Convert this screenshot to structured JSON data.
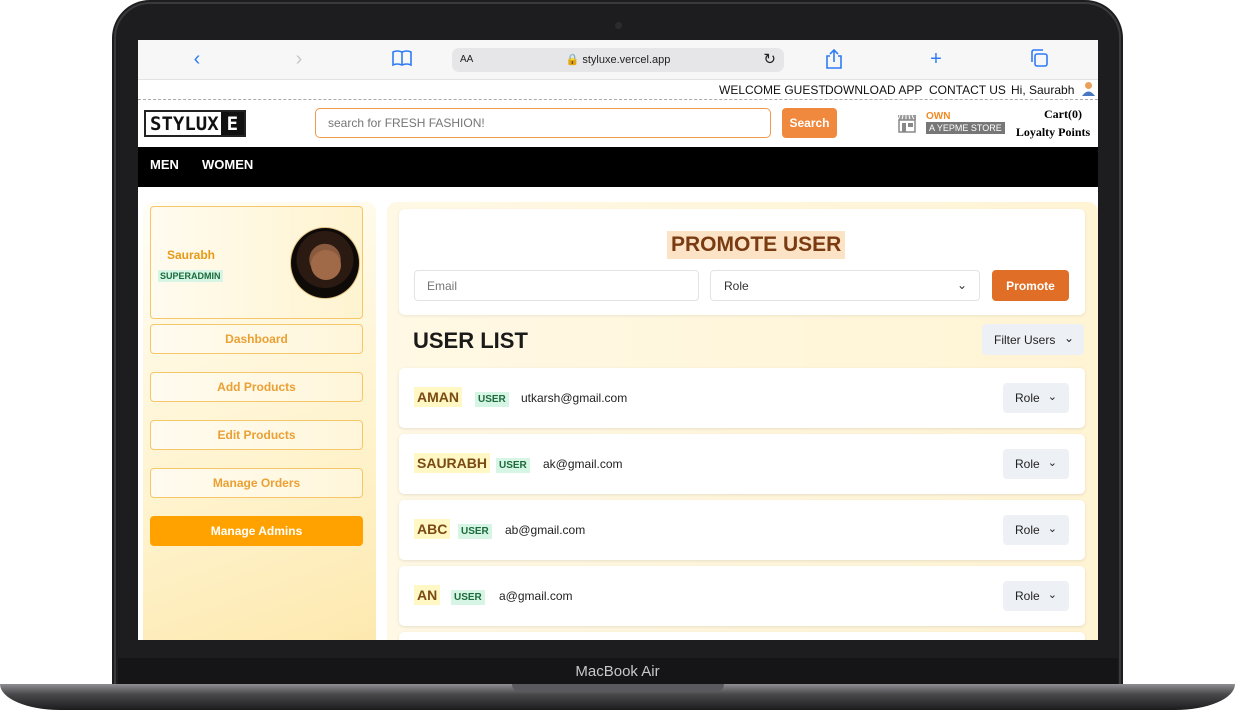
{
  "device": {
    "label": "MacBook Air"
  },
  "browser": {
    "aa": "AA",
    "url": "styluxe.vercel.app"
  },
  "top_links": {
    "welcome": "WELCOME GUEST",
    "download": "DOWNLOAD APP",
    "contact": "CONTACT US",
    "greeting": "Hi, Saurabh"
  },
  "header": {
    "logo_main": "STYLUX",
    "logo_end": "E",
    "search_placeholder": "search for FRESH FASHION!",
    "search_label": "Search",
    "own_label": "OWN",
    "store_label": "A YEPME STORE",
    "cart_label": "Cart(0)",
    "loyalty_label": "Loyalty Points"
  },
  "nav": {
    "men": "MEN",
    "women": "WOMEN"
  },
  "sidebar": {
    "profile": {
      "name": "Saurabh",
      "role": "SUPERADMIN"
    },
    "items": [
      "Dashboard",
      "Add Products",
      "Edit Products",
      "Manage Orders",
      "Manage Admins"
    ]
  },
  "promote": {
    "title": "PROMOTE USER",
    "email_placeholder": "Email",
    "role_placeholder": "Role",
    "button": "Promote"
  },
  "user_list": {
    "title": "USER LIST",
    "filter_label": "Filter Users",
    "role_label": "Role",
    "users": [
      {
        "name": "AMAN",
        "badge": "USER",
        "email": "utkarsh@gmail.com"
      },
      {
        "name": "SAURABH",
        "badge": "USER",
        "email": "ak@gmail.com"
      },
      {
        "name": "ABC",
        "badge": "USER",
        "email": "ab@gmail.com"
      },
      {
        "name": "AN",
        "badge": "USER",
        "email": "a@gmail.com"
      }
    ]
  }
}
